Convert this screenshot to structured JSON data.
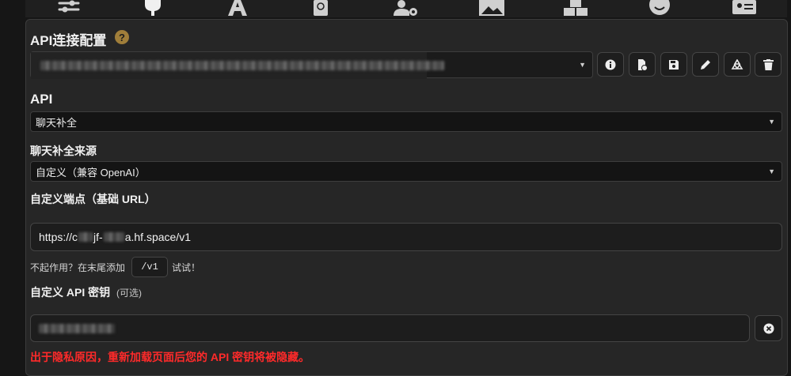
{
  "topnav": {
    "icons": [
      "sliders-icon",
      "plug-icon",
      "font-icon",
      "book-icon",
      "user-gear-icon",
      "image-icon",
      "cubes-icon",
      "smiley-icon",
      "id-card-icon"
    ]
  },
  "api_connection": {
    "title": "API连接配置",
    "help_label": "?",
    "profile_placeholder": "(profile name hidden)"
  },
  "api": {
    "label": "API",
    "selected": "聊天补全"
  },
  "source": {
    "label": "聊天补全来源",
    "selected": "自定义（兼容 OpenAI）"
  },
  "endpoint": {
    "label": "自定义端点（基础 URL）",
    "value_prefix": "https://c",
    "value_mid": "jf-",
    "value_suffix": "a.hf.space/v1",
    "hint_before": "不起作用？在末尾添加",
    "hint_code": "/v1",
    "hint_after": "试试！"
  },
  "key": {
    "label": "自定义 API 密钥",
    "optional": "(可选)",
    "warning": "出于隐私原因，重新加载页面后您的 API 密钥将被隐藏。"
  },
  "colors": {
    "warning": "#ff2a2a",
    "help_badge": "#a07e3a"
  }
}
